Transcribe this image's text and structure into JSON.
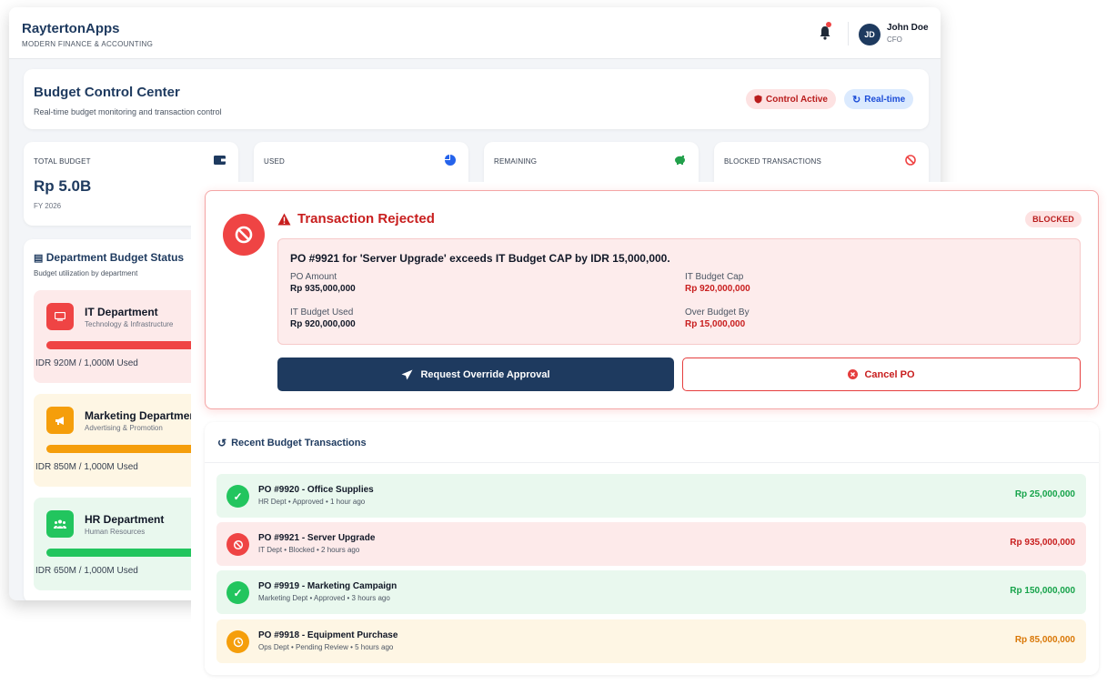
{
  "app": {
    "name": "RaytertonApps",
    "tagline": "MODERN FINANCE & ACCOUNTING"
  },
  "user": {
    "initials": "JD",
    "name": "John Doe",
    "role": "CFO"
  },
  "header": {
    "title": "Budget Control Center",
    "subtitle": "Real-time budget monitoring and transaction control",
    "control_badge": "Control Active",
    "realtime_badge": "Real-time"
  },
  "stats": [
    {
      "label": "TOTAL BUDGET",
      "value": "Rp 5.0B",
      "note": "FY 2026",
      "icon": "wallet-icon"
    },
    {
      "label": "USED",
      "value": "",
      "note": "",
      "icon": "pie-chart-icon"
    },
    {
      "label": "REMAINING",
      "value": "",
      "note": "",
      "icon": "piggy-bank-icon"
    },
    {
      "label": "BLOCKED TRANSACTIONS",
      "value": "",
      "note": "",
      "icon": "ban-icon"
    }
  ],
  "departments": {
    "title": "Department Budget Status",
    "subtitle": "Budget utilization by department",
    "items": [
      {
        "name": "IT Department",
        "desc": "Technology & Infrastructure",
        "used": "IDR 920M / 1,000M Used",
        "color": "#ef4444",
        "bg": "#fdeaea",
        "icon": "server-icon"
      },
      {
        "name": "Marketing Department",
        "desc": "Advertising & Promotion",
        "used": "IDR 850M / 1,000M Used",
        "color": "#f59e0b",
        "bg": "#fef6e4",
        "icon": "megaphone-icon"
      },
      {
        "name": "HR Department",
        "desc": "Human Resources",
        "used": "IDR 650M / 1,000M Used",
        "color": "#22c55e",
        "bg": "#e9f8ee",
        "icon": "users-icon"
      }
    ]
  },
  "alert": {
    "title": "Transaction Rejected",
    "badge": "BLOCKED",
    "message": "PO #9921 for 'Server Upgrade' exceeds IT Budget CAP by IDR 15,000,000.",
    "po_amount_label": "PO Amount",
    "po_amount": "Rp 935,000,000",
    "cap_label": "IT Budget Cap",
    "cap": "Rp 920,000,000",
    "used_label": "IT Budget Used",
    "used": "Rp 920,000,000",
    "over_label": "Over Budget By",
    "over": "Rp 15,000,000",
    "override_button": "Request Override Approval",
    "cancel_button": "Cancel PO"
  },
  "recent": {
    "title": "Recent Budget Transactions",
    "items": [
      {
        "title": "PO #9920 - Office Supplies",
        "sub": "HR Dept • Approved • 1 hour ago",
        "amount": "Rp 25,000,000",
        "status": "approved"
      },
      {
        "title": "PO #9921 - Server Upgrade",
        "sub": "IT Dept • Blocked • 2 hours ago",
        "amount": "Rp 935,000,000",
        "status": "blocked"
      },
      {
        "title": "PO #9919 - Marketing Campaign",
        "sub": "Marketing Dept • Approved • 3 hours ago",
        "amount": "Rp 150,000,000",
        "status": "approved"
      },
      {
        "title": "PO #9918 - Equipment Purchase",
        "sub": "Ops Dept • Pending Review • 5 hours ago",
        "amount": "Rp 85,000,000",
        "status": "pending"
      }
    ]
  },
  "colors": {
    "primary": "#1e3a5f",
    "danger": "#ef4444",
    "success": "#22c55e",
    "warning": "#f59e0b"
  }
}
